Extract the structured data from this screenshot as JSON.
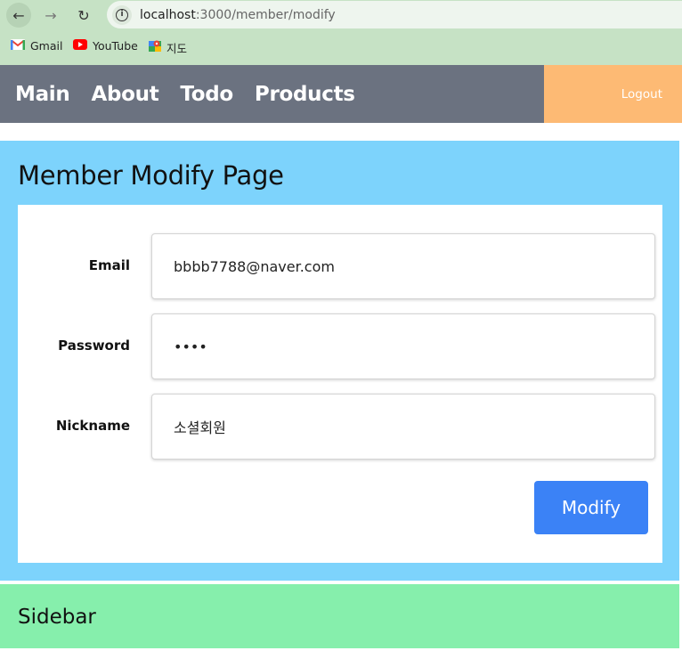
{
  "browser": {
    "url_host": "localhost",
    "url_path": ":3000/member/modify",
    "bookmarks": [
      {
        "label": "Gmail",
        "icon": "gmail-icon"
      },
      {
        "label": "YouTube",
        "icon": "youtube-icon"
      },
      {
        "label": "지도",
        "icon": "maps-icon"
      }
    ],
    "colors": {
      "chrome": "#c6e2c5"
    }
  },
  "header": {
    "nav": [
      "Main",
      "About",
      "Todo",
      "Products"
    ],
    "logout_label": "Logout",
    "colors": {
      "nav_bg": "#6b7280",
      "logout_bg": "#fdba74"
    }
  },
  "main": {
    "title": "Member Modify Page",
    "form": {
      "email_label": "Email",
      "email_value": "bbbb7788@naver.com",
      "password_label": "Password",
      "password_value": "••••",
      "nickname_label": "Nickname",
      "nickname_value": "소셜회원",
      "submit_label": "Modify"
    },
    "colors": {
      "bg": "#7dd3fc",
      "button": "#3b82f6"
    }
  },
  "sidebar": {
    "title": "Sidebar",
    "colors": {
      "bg": "#86efac"
    }
  }
}
